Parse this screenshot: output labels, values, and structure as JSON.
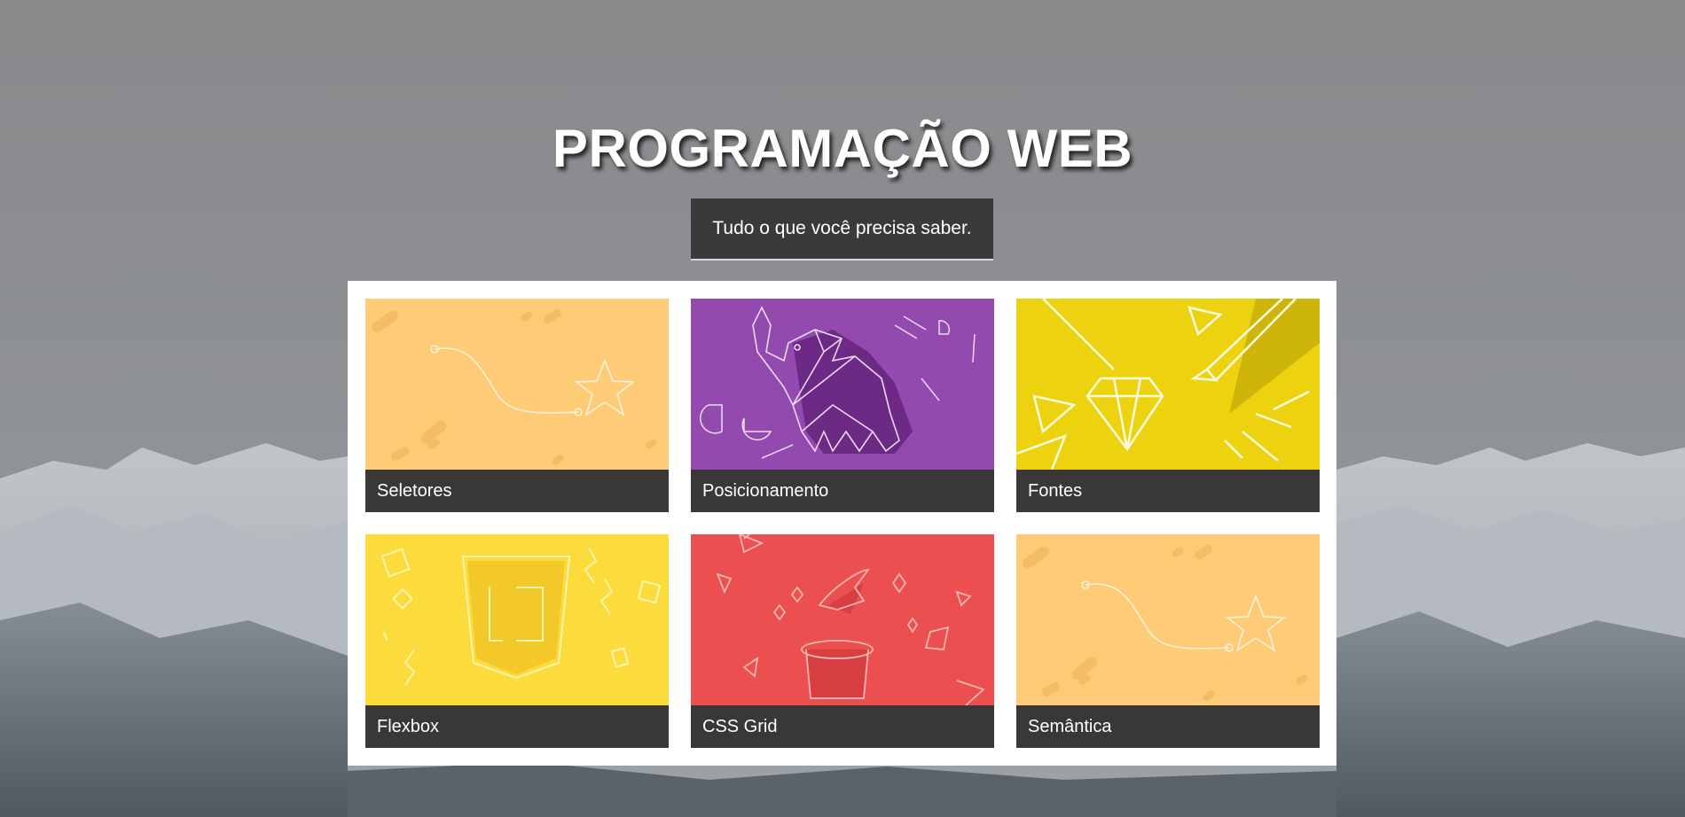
{
  "header": {
    "title": "PROGRAMAÇÃO WEB",
    "subtitle": "Tudo o que você precisa saber."
  },
  "cards": [
    {
      "label": "Seletores",
      "color": "#fecb77",
      "icon": "star-path-illustration"
    },
    {
      "label": "Posicionamento",
      "color": "#934aaf",
      "icon": "origami-elephant-illustration"
    },
    {
      "label": "Fontes",
      "color": "#edd30f",
      "icon": "diamond-pencil-illustration"
    },
    {
      "label": "Flexbox",
      "color": "#fcdc3c",
      "icon": "js-shield-illustration"
    },
    {
      "label": "CSS Grid",
      "color": "#ec4f4f",
      "icon": "magic-hat-bird-illustration"
    },
    {
      "label": "Semântica",
      "color": "#fecb77",
      "icon": "star-path-illustration"
    }
  ],
  "theme": {
    "caption_bg": "#3a3737",
    "subtitle_bg": "#3a3a3c",
    "panel_bg": "#ffffff"
  }
}
